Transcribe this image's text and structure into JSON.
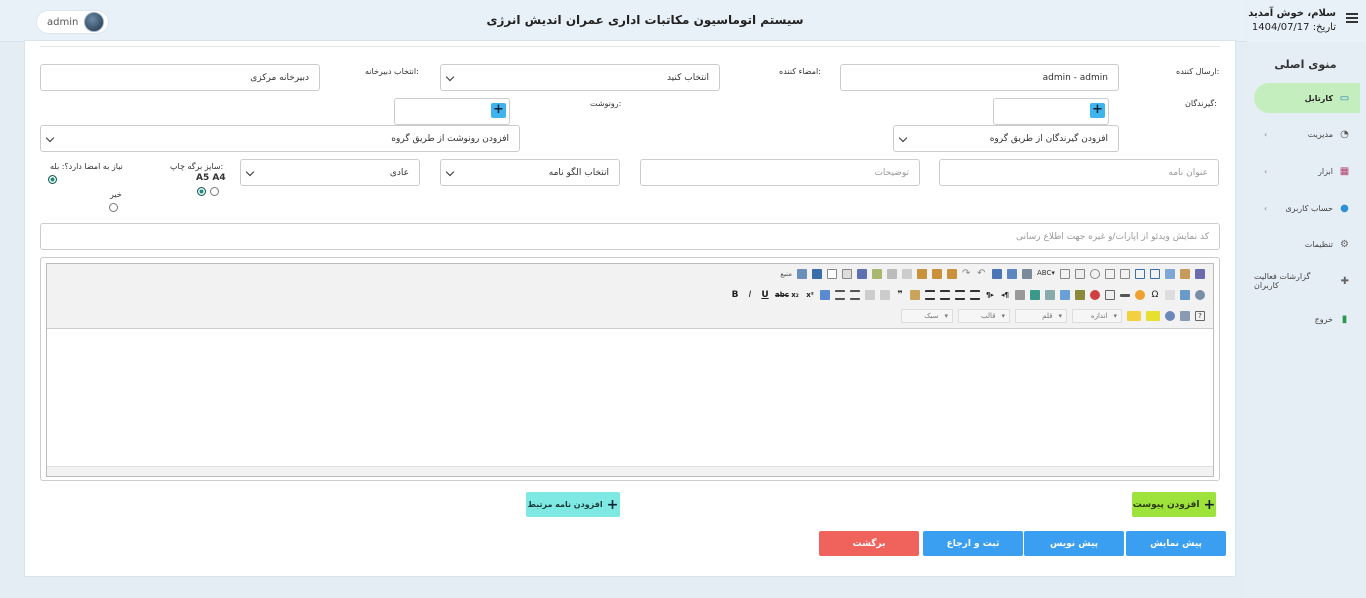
{
  "header": {
    "title": "سیستم اتوماسیون مکاتبات اداری عمران اندیش انرژی",
    "user": "admin"
  },
  "greeting": {
    "hello": "سلام، خوش آمدید",
    "date_label": "تاریخ:",
    "date": "1404/07/17"
  },
  "menu": {
    "title": "منوی اصلی",
    "items": [
      {
        "label": "کارتابل",
        "icon": "laptop-icon"
      },
      {
        "label": "مدیریت",
        "icon": "dashboard-icon"
      },
      {
        "label": "ابزار",
        "icon": "tools-icon"
      },
      {
        "label": "حساب کاربری",
        "icon": "user-gear-icon"
      },
      {
        "label": "تنظیمات",
        "icon": "gears-icon"
      },
      {
        "label": "گزارشات فعالیت کاربران",
        "icon": "puzzle-icon"
      },
      {
        "label": "خروج",
        "icon": "exit-icon"
      }
    ]
  },
  "form": {
    "sender_label": "ارسال کننده:",
    "sender_value": "admin - admin",
    "signer_label": "امضاء کننده:",
    "signer_value": "انتخاب کنید",
    "secretariat_label": "انتخاب دبیرخانه:",
    "secretariat_value": "دبیرخانه مرکزی",
    "recipients_label": "گیرندگان:",
    "recipients_group": "افزودن گیرندگان از طریق گروه",
    "cc_label": "رونوشت:",
    "cc_group": "افزودن رونوشت از طریق گروه",
    "subject_placeholder": "عنوان نامه",
    "description_placeholder": "توضیحات",
    "template_value": "انتخاب الگو نامه",
    "priority_value": "عادی",
    "print_size_label": "سایز برگه چاپ:",
    "print_size_a5": "A5",
    "print_size_a4": "A4",
    "need_sign_label": "نیاز به امضا دارد؟: بله",
    "need_sign_no": "خیر",
    "video_placeholder": "کد نمایش ویدئو از اپارات/و غیره جهت اطلاع رسانی"
  },
  "editor": {
    "style": "سبک",
    "format": "قالب",
    "font": "قلم",
    "size": "اندازه",
    "source": "منبع"
  },
  "buttons": {
    "attach": "افزودن پیوست",
    "related": "افزودن نامه مرتبط",
    "preview": "پیش نمایش",
    "draft": "پیش نویس",
    "send": "ثبت و ارجاع",
    "back": "برگشت"
  },
  "colors": {
    "attach": "#9ee23c",
    "related": "#7ee9e3",
    "blue": "#3a9ff0",
    "back": "#f0625c",
    "active_menu": "#c5eebf"
  }
}
